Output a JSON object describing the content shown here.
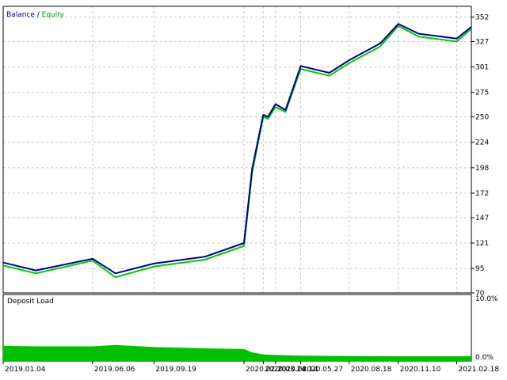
{
  "legend": {
    "balance_label": "Balance",
    "separator": " / ",
    "equity_label": "Equity"
  },
  "colors": {
    "balance": "#00008b",
    "equity": "#00c800",
    "deposit_load": "#00c000",
    "grid": "#c8c8c8",
    "axis": "#000000",
    "background": "#ffffff"
  },
  "chart_data": [
    {
      "type": "line",
      "title": "Balance / Equity",
      "x": [
        "2019.01.04",
        "2019.03.01",
        "2019.06.06",
        "2019.07.15",
        "2019.09.19",
        "2019.12.15",
        "2020.02.20",
        "2020.03.05",
        "2020.03.24",
        "2020.04.01",
        "2020.04.14",
        "2020.05.01",
        "2020.05.27",
        "2020.07.15",
        "2020.08.18",
        "2020.10.10",
        "2020.11.10",
        "2020.12.15",
        "2021.02.18",
        "2021.03.15"
      ],
      "series": [
        {
          "name": "Balance",
          "values": [
            101,
            93,
            105,
            90,
            100,
            107,
            121,
            197,
            252,
            250,
            263,
            257,
            302,
            295,
            308,
            325,
            345,
            335,
            330,
            342
          ]
        },
        {
          "name": "Equity",
          "values": [
            98,
            90,
            103,
            86,
            97,
            104,
            118,
            193,
            250,
            248,
            260,
            255,
            299,
            292,
            305,
            322,
            343,
            332,
            327,
            340
          ]
        }
      ],
      "y_ticks": [
        352,
        327,
        301,
        275,
        250,
        224,
        198,
        172,
        147,
        121,
        95,
        70
      ],
      "ylim": [
        70,
        363
      ],
      "x_tick_labels": [
        "2019.01.04",
        "2019.06.06",
        "2019.09.19",
        "2020.02.20",
        "2020.03.24",
        "2020.04.14",
        "2020.05.27",
        "2020.08.18",
        "2020.11.10",
        "2021.02.18"
      ],
      "grid": true,
      "legend_position": "top-left"
    },
    {
      "type": "area",
      "title": "Deposit Load",
      "x": [
        "2019.01.04",
        "2019.03.01",
        "2019.06.06",
        "2019.07.15",
        "2019.09.19",
        "2019.12.15",
        "2020.02.20",
        "2020.03.05",
        "2020.03.24",
        "2020.04.14",
        "2020.05.27",
        "2020.08.18",
        "2020.11.10",
        "2021.02.18",
        "2021.03.15"
      ],
      "series": [
        {
          "name": "Deposit Load",
          "values": [
            2.3,
            2.2,
            2.2,
            2.4,
            2.1,
            1.9,
            1.8,
            1.3,
            1.0,
            0.9,
            0.8,
            0.75,
            0.72,
            0.72,
            0.72
          ]
        }
      ],
      "y_ticks_labels": [
        "10.0%",
        "0.0%"
      ],
      "ylim": [
        0,
        10
      ]
    }
  ]
}
